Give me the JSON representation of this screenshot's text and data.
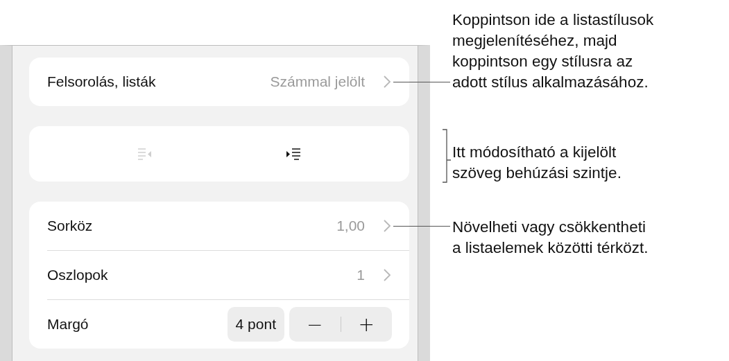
{
  "list_style": {
    "label": "Felsorolás, listák",
    "value": "Számmal jelölt"
  },
  "indent_buttons": [
    {
      "kind": "decrease",
      "disabled": true
    },
    {
      "kind": "increase",
      "disabled": false
    }
  ],
  "rows": [
    {
      "kind": "disclosure",
      "label": "Sorköz",
      "value": "1,00"
    },
    {
      "kind": "disclosure",
      "label": "Oszlopok",
      "value": "1"
    },
    {
      "kind": "stepper",
      "label": "Margó",
      "value": "4 pont",
      "minus": "−",
      "plus": "+"
    }
  ],
  "callouts": [
    {
      "kind": "line",
      "lines": [
        "Koppintson ide a listastílusok",
        "megjelenítéséhez, majd",
        "koppintson egy stílusra az",
        "adott stílus alkalmazásához."
      ]
    },
    {
      "kind": "bracket",
      "lines": [
        "Itt módosítható a kijelölt",
        "szöveg behúzási szintje."
      ]
    },
    {
      "kind": "line",
      "lines": [
        "Növelheti vagy csökkentheti",
        "a listaelemek közötti térközt."
      ]
    }
  ]
}
